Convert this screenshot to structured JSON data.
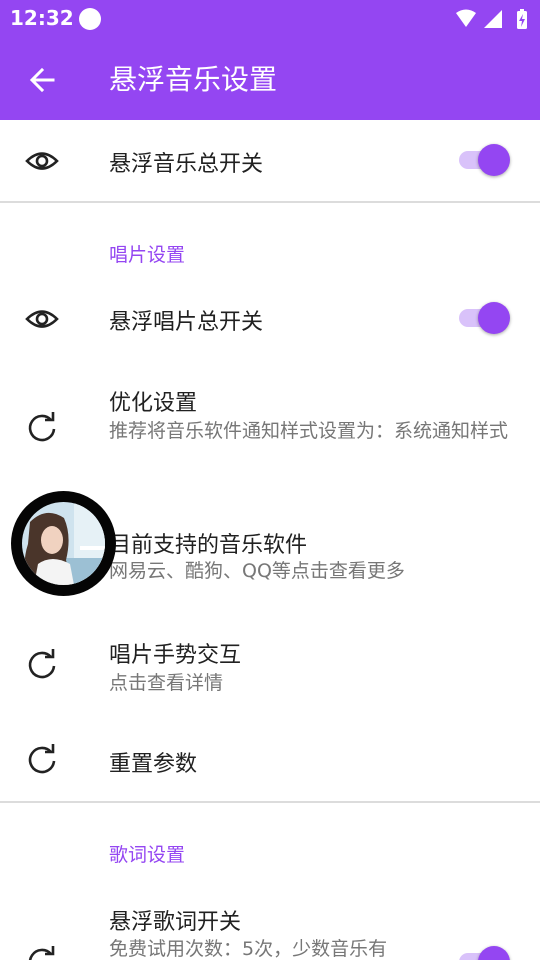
{
  "status_bar": {
    "time": "12:32"
  },
  "app_bar": {
    "title": "悬浮音乐设置"
  },
  "rows": {
    "master_switch": {
      "title": "悬浮音乐总开关",
      "checked": true
    },
    "disc_section": "唱片设置",
    "disc_switch": {
      "title": "悬浮唱片总开关",
      "checked": true
    },
    "optimize": {
      "title": "优化设置",
      "subtitle": "推荐将音乐软件通知样式设置为：系统通知样式"
    },
    "supported_apps": {
      "title": "目前支持的音乐软件",
      "subtitle": "网易云、酷狗、QQ等点击查看更多"
    },
    "gesture": {
      "title": "唱片手势交互",
      "subtitle": "点击查看详情"
    },
    "reset": {
      "title": "重置参数"
    },
    "lyrics_section": "歌词设置",
    "lyrics_switch": {
      "title": "悬浮歌词开关",
      "subtitle": "免费试用次数：5次，少数音乐有",
      "checked": true
    }
  },
  "icons": {
    "back": "arrow-left-icon",
    "eye": "eye-icon",
    "refresh": "refresh-icon",
    "wifi": "wifi-icon",
    "signal": "signal-icon",
    "battery": "battery-charging-icon",
    "floating_disc": "album-cover-icon"
  },
  "colors": {
    "accent": "#9446f2",
    "switch_track": "#d9c2fa",
    "divider": "#dcdcdc",
    "secondary_text": "#777777",
    "disc_ring": "#050505"
  }
}
